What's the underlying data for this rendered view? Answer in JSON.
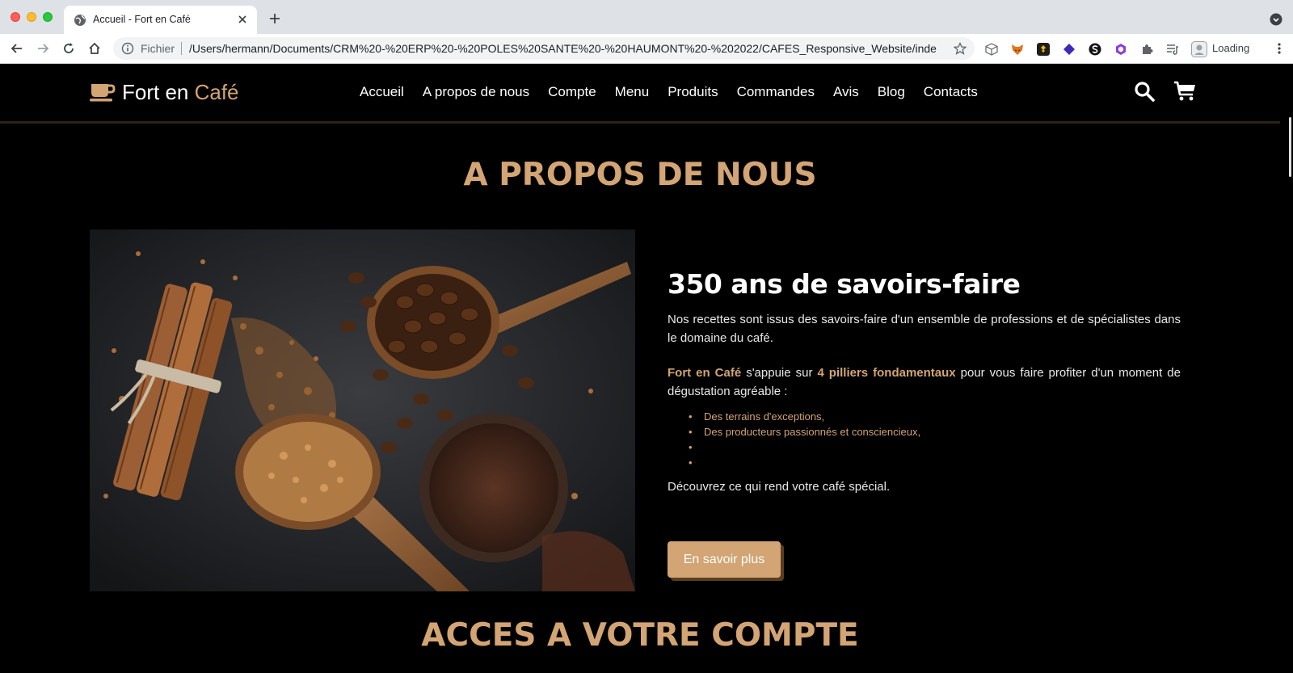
{
  "browser": {
    "tab_title": "Accueil - Fort en Café",
    "omnibox_scheme": "Fichier",
    "omnibox_url": "/Users/hermann/Documents/CRM%20-%20ERP%20-%20POLES%20SANTE%20-%20HAUMONT%20-%202022/CAFES_Responsive_Website/index....",
    "profile_label": "Loading"
  },
  "header": {
    "logo_main": "Fort en ",
    "logo_accent": "Café",
    "nav": [
      "Accueil",
      "A propos de nous",
      "Compte",
      "Menu",
      "Produits",
      "Commandes",
      "Avis",
      "Blog",
      "Contacts"
    ]
  },
  "about": {
    "title": "A PROPOS DE NOUS",
    "heading": "350 ans de savoirs-faire",
    "p1": "Nos recettes sont issus des savoirs-faire d'un ensemble de professions et de spécialistes dans le domaine du café.",
    "p2_brand": "Fort en Café",
    "p2_mid": " s'appuie sur ",
    "p2_strong": "4 pilliers fondamentaux",
    "p2_end": " pour vous faire profiter d'un moment de dégustation agréable :",
    "pillars": [
      "Des terrains d'exceptions,",
      "Des producteurs passionnés et consciencieux,",
      "",
      ""
    ],
    "discover": "Découvrez ce qui rend votre café spécial.",
    "cta": "En savoir plus"
  },
  "account": {
    "title": "ACCES A VOTRE COMPTE"
  },
  "colors": {
    "accent": "#d3a474",
    "background": "#000000"
  }
}
